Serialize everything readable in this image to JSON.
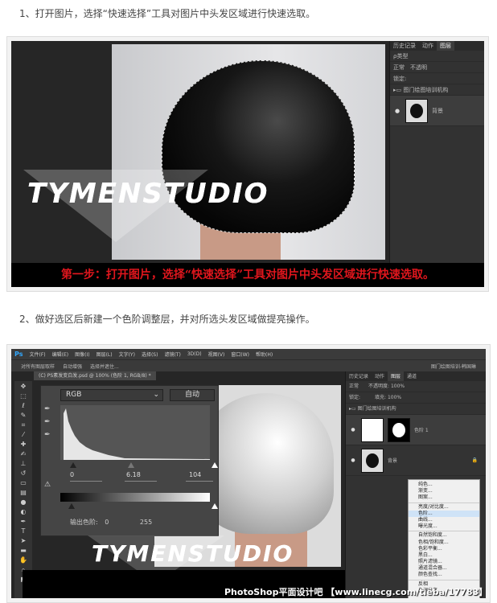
{
  "steps": [
    {
      "text": "1、打开图片，选择“快速选择”工具对图片中头发区域进行快速选取。"
    },
    {
      "text": "2、做好选区后新建一个色阶调整层，并对所选头发区域做提亮操作。"
    }
  ],
  "shot1": {
    "logo": "TYMENSTUDIO",
    "banner": "第一步：打开图片，选择“快速选择”工具对图片中头发区域进行快速选取。",
    "panel": {
      "tabs": [
        "历史记录",
        "动作",
        "图层"
      ],
      "kind": "ρ类型",
      "blend": "正常",
      "opacity": "不透明",
      "lock": "锁定:",
      "group": "图门绘图培训机构",
      "layer": "背景"
    }
  },
  "shot2": {
    "menu": [
      "Ps",
      "文件(F)",
      "编辑(E)",
      "图像(I)",
      "图层(L)",
      "文字(Y)",
      "选择(S)",
      "滤镜(T)",
      "3D(D)",
      "视图(V)",
      "窗口(W)",
      "帮助(H)"
    ],
    "options": [
      "对所有图层取样",
      "自动增强",
      "选择并遮住..."
    ],
    "doc_tab": "(C) PS素发变白发.psd @ 100% (色阶 1, RGB/8) *",
    "workspace": "图门绘图培训-韩国琳",
    "levels": {
      "channel": "RGB",
      "auto": "自动",
      "input": [
        "0",
        "6.18",
        "104"
      ],
      "output_label": "输出色阶:",
      "output": [
        "0",
        "255"
      ]
    },
    "logo": "TYMENSTUDIO",
    "panel": {
      "tabs": [
        "历史记录",
        "动作",
        "图层",
        "通道"
      ],
      "blend": "正常",
      "opacity": "不透明度: 100%",
      "fill": "填充: 100%",
      "lock": "锁定:",
      "group": "图门绘图培训机构",
      "layer_adj": "色阶 1",
      "layer_bg": "背景"
    },
    "adj_menu": [
      "纯色...",
      "渐变...",
      "图案...",
      "亮度/对比度...",
      "色阶...",
      "曲线...",
      "曝光度...",
      "自然饱和度...",
      "色相/饱和度...",
      "色彩平衡...",
      "黑白...",
      "照片滤镜...",
      "通道混合器...",
      "颜色查找...",
      "反相",
      "色调分离..."
    ],
    "watermark": "PhotoShop平面设计吧 【www.linecg.com/tieba/17783】"
  }
}
